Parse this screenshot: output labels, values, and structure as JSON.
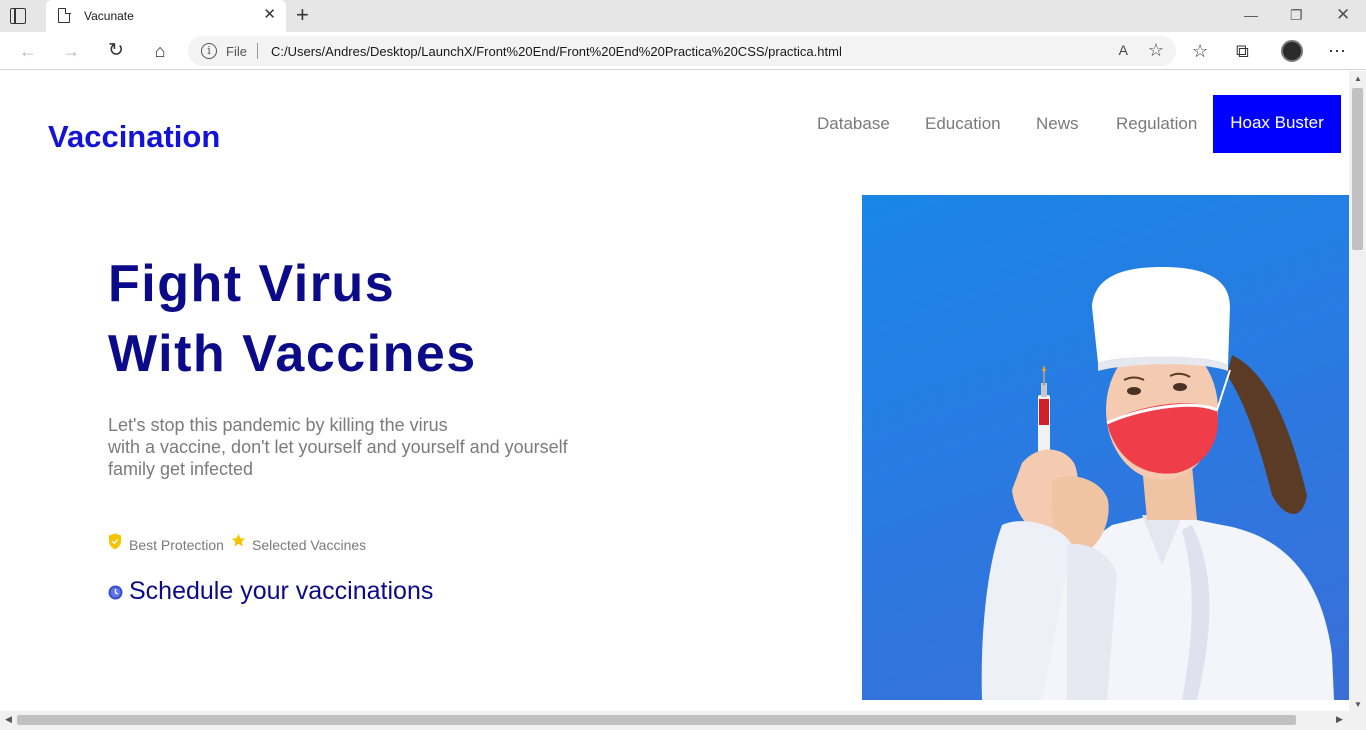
{
  "browser": {
    "tab_title": "Vacunate",
    "tab_close": "✕",
    "new_tab": "+",
    "window_min": "—",
    "window_max": "❐",
    "window_close": "✕",
    "address": {
      "scheme_label": "File",
      "url": "C:/Users/Andres/Desktop/LaunchX/Front%20End/Front%20End%20Practica%20CSS/practica.html"
    },
    "icons": {
      "back": "←",
      "forward": "→",
      "reload": "↻",
      "home": "⌂",
      "info": "i",
      "read_aloud": "A",
      "add_favorite": "☆",
      "favorites": "☆",
      "collections": "⧉",
      "more": "⋯"
    }
  },
  "page": {
    "logo": "Vaccination",
    "nav": {
      "items": [
        "Database",
        "Education",
        "News",
        "Regulation"
      ],
      "cta": "Hoax Buster"
    },
    "hero": {
      "title_lines": [
        "Fight Virus",
        "With Vaccines"
      ],
      "description_lines": [
        "Let's stop this pandemic by killing the virus",
        "with a vaccine, don't let yourself and yourself and yourself",
        "family get infected"
      ],
      "features": [
        "Best Protection",
        "Selected Vaccines"
      ],
      "schedule": "Schedule your vaccinations"
    },
    "colors": {
      "brand": "#1414d8",
      "title": "#0b0b8a",
      "cta_bg": "#0000ff",
      "image_bg": "#1a86e6",
      "icon_yellow": "#f5c400"
    }
  }
}
